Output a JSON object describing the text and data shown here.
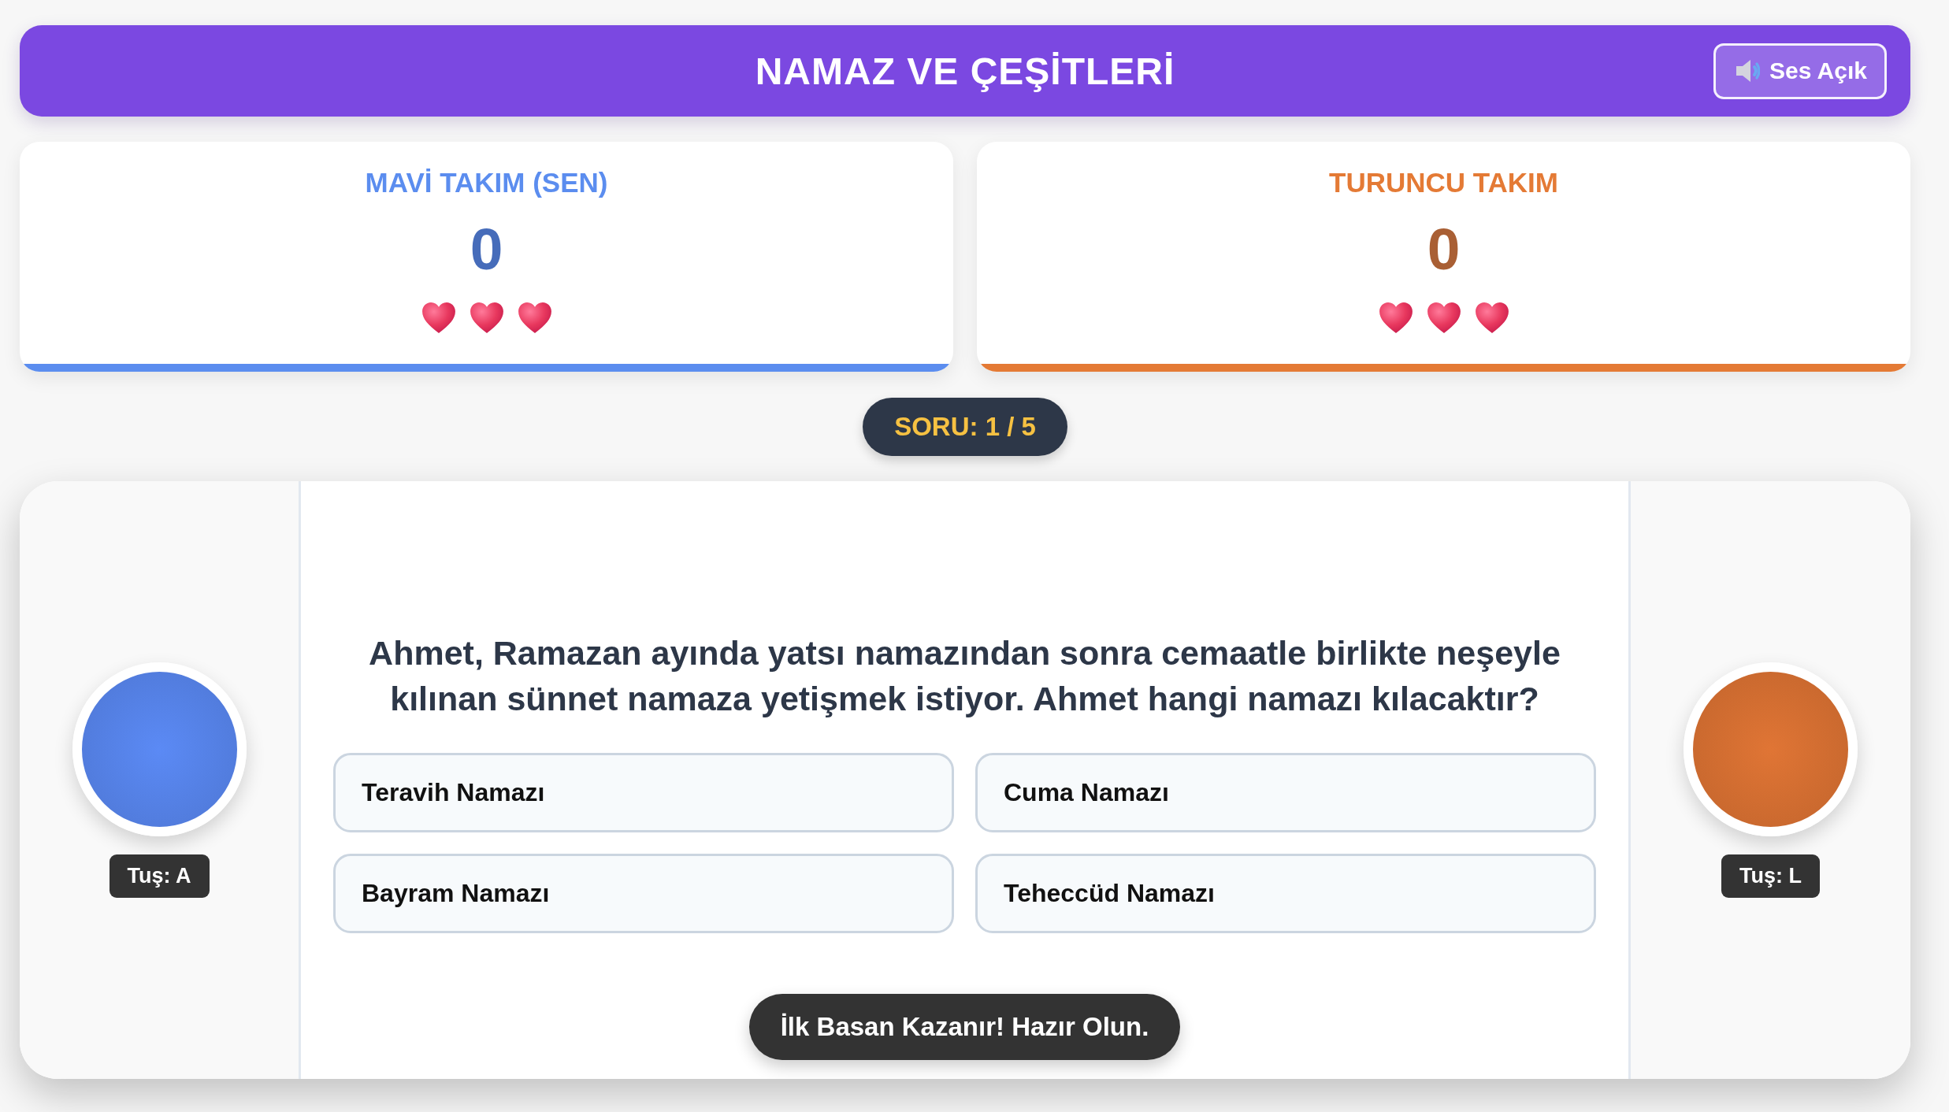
{
  "header": {
    "title": "NAMAZ VE ÇEŞİTLERİ",
    "sound_button": {
      "label": "Ses Açık"
    }
  },
  "teams": [
    {
      "name": "MAVİ TAKIM (SEN)",
      "score": "0",
      "color": "#5b8def",
      "hearts": [
        {
          "filled": true
        },
        {
          "filled": true
        },
        {
          "filled": true
        }
      ]
    },
    {
      "name": "TURUNCU TAKIM",
      "score": "0",
      "color": "#e47a35",
      "hearts": [
        {
          "filled": true
        },
        {
          "filled": true
        },
        {
          "filled": true
        }
      ]
    }
  ],
  "question_counter": "SORU: 1 / 5",
  "game": {
    "buzzers": [
      {
        "key_hint": "Tuş: A",
        "color": "#5b8af5"
      },
      {
        "key_hint": "Tuş: L",
        "color": "#e07535"
      }
    ],
    "question": "Ahmet, Ramazan ayında yatsı namazından sonra cemaatle birlikte neşeyle kılınan sünnet namaza yetişmek istiyor. Ahmet hangi namazı kılacaktır?",
    "answers": [
      {
        "text": "Teravih Namazı",
        "selected": false
      },
      {
        "text": "Cuma Namazı",
        "selected": false
      },
      {
        "text": "Bayram Namazı",
        "selected": false
      },
      {
        "text": "Teheccüd Namazı",
        "selected": false
      }
    ],
    "status_message": "İlk Basan Kazanır! Hazır Olun."
  }
}
